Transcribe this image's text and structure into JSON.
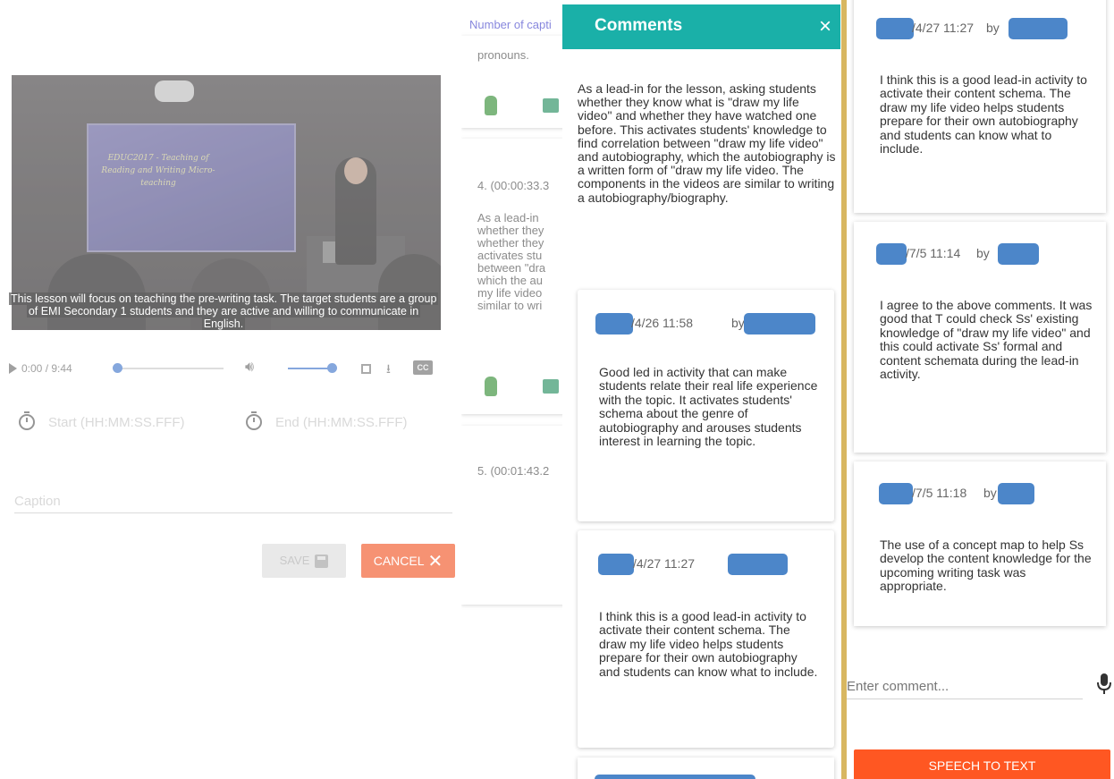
{
  "video": {
    "screen_text": "EDUC2017 - Teaching of Reading and Writing Micro-teaching",
    "subtitle": "This lesson will focus on teaching the pre-writing task. The target students are a group of EMI Secondary 1 students and they are active and willing to communicate in English.",
    "time": "0:00 / 9:44",
    "progress_fraction": 0.0,
    "volume_fraction": 1.0,
    "cc_label": "CC"
  },
  "editor": {
    "start_placeholder": "Start (HH:MM:SS.FFF)",
    "end_placeholder": "End (HH:MM:SS.FFF)",
    "caption_placeholder": "Caption",
    "save_label": "SAVE",
    "cancel_label": "CANCEL"
  },
  "caption_list": {
    "header": "Number of capti",
    "card1_tail": "pronouns.",
    "card2_stamp": "4. (00:00:33.3",
    "card2_lines": [
      "As a lead-in",
      "whether they",
      "whether they",
      "activates stu",
      "between \"dra",
      "which the au",
      "my life video",
      "similar to wri"
    ],
    "card3_stamp": "5. (00:01:43.2"
  },
  "comments": {
    "title": "Comments",
    "close_label": "×",
    "caption_text": "As a lead-in for the lesson, asking students whether they know what is \"draw my life video\" and whether they have watched one before. This activates students' knowledge to find correlation between \"draw my life video\" and autobiography, which the autobiography is a written form of \"draw my life video. The components in the videos are similar to writing a autobiography/biography.",
    "items": [
      {
        "date": "/4/26 11:58",
        "by": "by",
        "text": "Good led in activity that can make students relate their real life experience with the topic. It activates students' schema about the genre of autobiography and arouses students interest in learning the topic."
      },
      {
        "date": "/4/27 11:27",
        "by": "by",
        "text": "I think this is a good lead-in activity to activate their content schema. The draw my life video helps students prepare for their own autobiography and students can know what to include."
      }
    ]
  },
  "right_panel": {
    "items": [
      {
        "date": "/4/27 11:27",
        "by": "by",
        "text": "I think this is a good lead-in activity to activate their content schema. The draw my life video helps students prepare for their own autobiography and students can know what to include."
      },
      {
        "date": "/7/5 11:14",
        "by": "by",
        "text": "I agree to the above comments. It was good that T could check Ss' existing knowledge of \"draw my life video\" and this could activate Ss' formal and content schemata during the lead-in activity."
      },
      {
        "date": "/7/5 11:18",
        "by": "by",
        "text": "The use of a concept map to help Ss develop the content knowledge for the upcoming writing task was appropriate."
      }
    ],
    "input_placeholder": "Enter comment...",
    "speech_button_label": "SPEECH TO TEXT"
  },
  "colors": {
    "header_teal": "#1ab0a8",
    "cancel_orange": "#f0501e",
    "speech_orange": "#ff5722",
    "divider_gold": "#d8b761",
    "redaction_blue": "#4c86c9"
  }
}
